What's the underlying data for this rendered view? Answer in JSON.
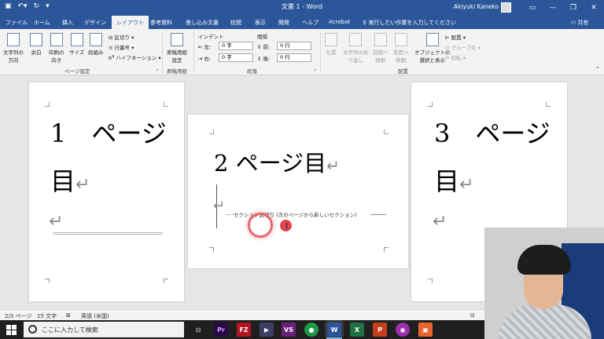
{
  "window": {
    "title": "文書 1 - Word",
    "user_name": "Akiyuki Kaneko"
  },
  "tabs": [
    "ファイル",
    "ホーム",
    "挿入",
    "デザイン",
    "レイアウト",
    "参考資料",
    "差し込み文書",
    "校閲",
    "表示",
    "開発",
    "ヘルプ",
    "Acrobat"
  ],
  "active_tab": "レイアウト",
  "tell_me": "実行したい作業を入力してください",
  "share_label": "共有",
  "ribbon": {
    "page_setup": {
      "label": "ページ設定",
      "text_direction": [
        "文字列の",
        "方向"
      ],
      "margins": "余白",
      "orientation": [
        "印刷の",
        "向き"
      ],
      "size": "サイズ",
      "columns": "段組み",
      "breaks": "区切り",
      "line_numbers": "行番号",
      "hyphenation": "ハイフネーション"
    },
    "genko": {
      "label": "原稿用紙",
      "button": [
        "原稿用紙",
        "設定"
      ]
    },
    "paragraph": {
      "label": "段落",
      "indent_header": "インデント",
      "spacing_header": "間隔",
      "indent_left_label": "左:",
      "indent_left_value": "0 字",
      "indent_right_label": "右:",
      "indent_right_value": "0 字",
      "spacing_before_label": "前:",
      "spacing_before_value": "0 行",
      "spacing_after_label": "後:",
      "spacing_after_value": "0 行"
    },
    "arrange": {
      "label": "配置",
      "position": "位置",
      "wrap_text": [
        "文字列の折",
        "り返し"
      ],
      "bring_forward": [
        "前面へ",
        "移動"
      ],
      "send_backward": [
        "背面へ",
        "移動"
      ],
      "selection_pane": [
        "オブジェクトの",
        "選択と表示"
      ],
      "align": "配置",
      "group": "グループ化",
      "rotate": "回転"
    }
  },
  "document": {
    "page1": {
      "line1": "1　ページ",
      "line2": "目"
    },
    "page2": {
      "text": "2 ページ目",
      "section_break": "セクション区切り (次のページから新しいセクション)"
    },
    "page3": {
      "line1": "3　ページ",
      "line2": "目"
    },
    "return_mark": "↵"
  },
  "status": {
    "page": "2/3 ページ",
    "words": "15 文字",
    "language": "英語 (米国)"
  },
  "taskbar": {
    "search_placeholder": "ここに入力して検索",
    "apps": [
      "Pr",
      "FZ",
      "VS",
      "W",
      "X",
      "P"
    ]
  },
  "colors": {
    "word_blue": "#2b579a",
    "click_indicator": "#e0474c"
  }
}
